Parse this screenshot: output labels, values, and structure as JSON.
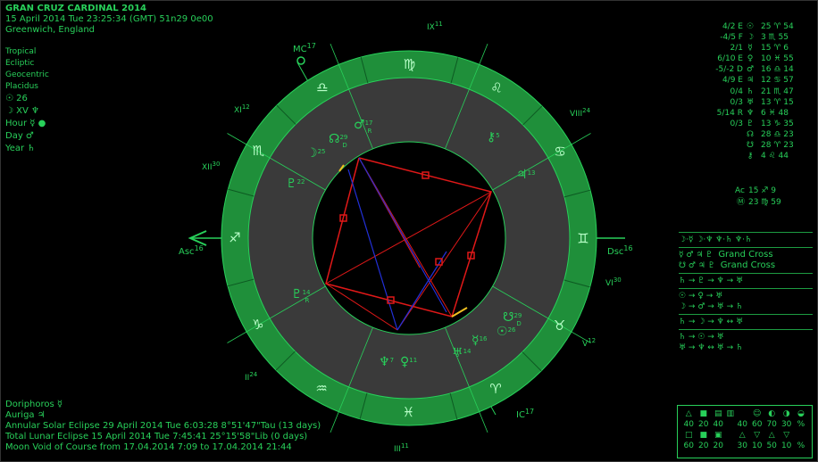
{
  "header": {
    "title": "GRAN CRUZ CARDINAL 2014",
    "datetime": "15 April 2014  Tue  23:25:34 (GMT) 51n29  0e00",
    "place": "Greenwich, England"
  },
  "settings": {
    "zodiac": "Tropical",
    "coord": "Ecliptic",
    "center": "Geocentric",
    "houses": "Placidus",
    "sun_day": "☉  26",
    "moon_day": "☽  XV  ♆",
    "hour": "Hour ☿",
    "day": "Day ♂",
    "year": "Year ♄"
  },
  "wheel": {
    "signs": [
      "♈",
      "♉",
      "♊",
      "♋",
      "♌",
      "♍",
      "♎",
      "♏",
      "♐",
      "♑",
      "♒",
      "♓"
    ],
    "asc_label": "Asc",
    "asc_deg": "16",
    "dsc_label": "Dsc",
    "dsc_deg": "16",
    "mc_label": "MC",
    "mc_deg": "17",
    "ic_label": "IC",
    "ic_deg": "17",
    "house_labels": [
      {
        "name": "II",
        "deg": "24"
      },
      {
        "name": "III",
        "deg": "11"
      },
      {
        "name": "V",
        "deg": "12"
      },
      {
        "name": "VI",
        "deg": "30"
      },
      {
        "name": "VIII",
        "deg": "24"
      },
      {
        "name": "IX",
        "deg": "11"
      },
      {
        "name": "XI",
        "deg": "12"
      },
      {
        "name": "XII",
        "deg": "30"
      }
    ],
    "planets": [
      {
        "glyph": "♂",
        "deg": "17",
        "note": "R"
      },
      {
        "glyph": "☊",
        "deg": "29",
        "note": "D"
      },
      {
        "glyph": "☽",
        "deg": "25",
        "note": ""
      },
      {
        "glyph": "⚷",
        "deg": "5",
        "note": ""
      },
      {
        "glyph": "♃",
        "deg": "13",
        "note": ""
      },
      {
        "glyph": "♇",
        "deg": "22",
        "note": ""
      },
      {
        "glyph": "♇",
        "deg": "14",
        "note": "R"
      },
      {
        "glyph": "♆",
        "deg": "7",
        "note": ""
      },
      {
        "glyph": "♀",
        "deg": "11",
        "note": ""
      },
      {
        "glyph": "♅",
        "deg": "14",
        "note": ""
      },
      {
        "glyph": "☋",
        "deg": "29",
        "note": "D"
      },
      {
        "glyph": "☉",
        "deg": "26",
        "note": ""
      },
      {
        "glyph": "☿",
        "deg": "16",
        "note": ""
      }
    ]
  },
  "positions": [
    {
      "aspect": "4/2 E",
      "glyph": "☉",
      "pos": "25 ♈ 54"
    },
    {
      "aspect": "-4/5 F",
      "glyph": "☽",
      "pos": "3 ♏ 55"
    },
    {
      "aspect": "2/1",
      "glyph": "☿",
      "pos": "15 ♈ 6"
    },
    {
      "aspect": "6/10 E",
      "glyph": "♀",
      "pos": "10 ♓ 55"
    },
    {
      "aspect": "-5/-2 D",
      "glyph": "♂",
      "pos": "16 ♎ 14"
    },
    {
      "aspect": "4/9 E",
      "glyph": "♃",
      "pos": "12 ♋ 57"
    },
    {
      "aspect": "0/4",
      "glyph": "♄",
      "pos": "21 ♏ 47"
    },
    {
      "aspect": "0/3",
      "glyph": "♅",
      "pos": "13 ♈ 15"
    },
    {
      "aspect": "5/14 R",
      "glyph": "♆",
      "pos": "6 ♓ 48"
    },
    {
      "aspect": "0/3",
      "glyph": "♇",
      "pos": "13 ♑ 35"
    },
    {
      "aspect": "",
      "glyph": "☊",
      "pos": "28 ♎ 23"
    },
    {
      "aspect": "",
      "glyph": "☋",
      "pos": "28 ♈ 23"
    },
    {
      "aspect": "",
      "glyph": "⚷",
      "pos": "4 ♌ 44"
    }
  ],
  "angles": [
    {
      "glyph": "Ac",
      "pos": "15 ♐ 9"
    },
    {
      "glyph": "Ⓜ",
      "pos": "23 ♍ 59"
    }
  ],
  "aspects": {
    "row1": "☽·☿   ☽·♆   ♆·♄   ♆·♄",
    "patterns": [
      {
        "glyphs": "☿ ♂ ♃ ♇",
        "label": "Grand Cross"
      },
      {
        "glyphs": "☋ ♂ ♃ ♇",
        "label": "Grand Cross"
      }
    ],
    "row3": "♄ → ♇ → ♆ → ♅",
    "row4": "☉ → ♀ → ♅",
    "row5": "☽ → ♂ → ♅ → ♄",
    "row6": "♄ → ☽ → ♆ ↔ ♅",
    "row7": "♄ → ☉ → ♅",
    "row8": "♅ → ♆ ↔ ♅ → ♄"
  },
  "stats": {
    "headers": [
      "△",
      "■",
      "▤",
      "▥",
      "",
      "☺",
      "◐",
      "◑",
      "◒"
    ],
    "row1": [
      "40",
      "20",
      "40",
      "",
      "40",
      "60",
      "70",
      "30",
      "%"
    ],
    "row2": [
      "□",
      "■",
      "▣",
      "",
      "△",
      "▽",
      "△",
      "▽",
      ""
    ],
    "row3": [
      "60",
      "20",
      "20",
      "",
      "30",
      "10",
      "50",
      "10",
      "%"
    ]
  },
  "footer": {
    "fixed_star": "Doriphoros  ☿",
    "auriga": "Auriga  ♃",
    "solar_eclipse": "Annular Solar Eclipse 29 April 2014 Tue  6:03:28  8°51'47\"Tau (13 days)",
    "lunar_eclipse": "Total Lunar Eclipse 15 April 2014 Tue  7:45:41 25°15'58\"Lib (0 days)",
    "void": "Moon Void of Course from 17.04.2014  7:09 to 17.04.2014 21:44"
  },
  "colors": {
    "accent": "#28d05a",
    "ring": "#1f8f3a",
    "houses": "#3a3a3a",
    "aspect_red": "#e01818",
    "aspect_blue": "#2230d8"
  }
}
